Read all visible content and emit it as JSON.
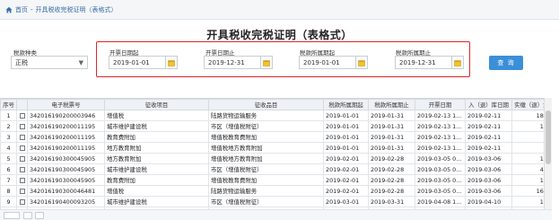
{
  "breadcrumb": {
    "home": "首页",
    "separator": "-",
    "current": "开具税收完税证明（表格式）"
  },
  "title": "开具税收完税证明（表格式）",
  "filters": {
    "tax_type": {
      "label": "税款种类",
      "value": "正税",
      "arrow": "▼"
    },
    "issue_start": {
      "label": "开票日期起",
      "value": "2019-01-01"
    },
    "issue_end": {
      "label": "开票日期止",
      "value": "2019-12-31"
    },
    "period_start": {
      "label": "税款所属期起",
      "value": "2019-01-01"
    },
    "period_end": {
      "label": "税款所属期止",
      "value": "2019-12-31"
    },
    "query_label": "查 询",
    "highlight_color": "#d9262b",
    "accent_color": "#3b8fd9"
  },
  "table": {
    "headers": [
      "序号",
      "",
      "电子税票号",
      "征收项目",
      "征收品目",
      "税款所属期起",
      "税款所属期止",
      "开票日期",
      "入（退）库日期",
      "实缴（退）金额"
    ],
    "rows": [
      [
        "1",
        "",
        "342016190200003946",
        "增值税",
        "陆路货物运输服务",
        "2019-01-01",
        "2019-01-31",
        "2019-02-13 1...",
        "2019-02-11",
        "18281"
      ],
      [
        "2",
        "",
        "342016190200011195",
        "城市维护建设税",
        "市区（增值税附征）",
        "2019-01-01",
        "2019-01-31",
        "2019-02-13 1...",
        "2019-02-11",
        "1280"
      ],
      [
        "3",
        "",
        "342016190200011195",
        "教育费附加",
        "增值税教育费附加",
        "2019-01-01",
        "2019-01-31",
        "2019-02-13 1...",
        "2019-02-11",
        "548"
      ],
      [
        "4",
        "",
        "342016190200011195",
        "地方教育附加",
        "增值税地方教育附加",
        "2019-01-01",
        "2019-01-31",
        "2019-02-13 1...",
        "2019-02-11",
        "365"
      ],
      [
        "5",
        "",
        "342016190300045905",
        "地方教育附加",
        "增值税地方教育附加",
        "2019-02-01",
        "2019-02-28",
        "2019-03-05 0...",
        "2019-03-06",
        "1144"
      ],
      [
        "6",
        "",
        "342016190300045905",
        "城市维护建设税",
        "市区（增值税附征）",
        "2019-02-01",
        "2019-02-28",
        "2019-03-05 0...",
        "2019-03-06",
        "4006"
      ],
      [
        "7",
        "",
        "342016190300045905",
        "教育费附加",
        "增值税教育费附加",
        "2019-02-01",
        "2019-02-28",
        "2019-03-05 0...",
        "2019-03-06",
        "1716"
      ],
      [
        "8",
        "",
        "342016190300046481",
        "增值税",
        "陆路货物运输服务",
        "2019-02-01",
        "2019-02-28",
        "2019-03-05 0...",
        "2019-03-06",
        "16353"
      ],
      [
        "9",
        "",
        "342016190400093205",
        "城市维护建设税",
        "市区（增值税附征）",
        "2019-03-01",
        "2019-03-31",
        "2019-04-08 1...",
        "2019-04-10",
        "1109"
      ],
      [
        "10",
        "",
        "342016190400093205",
        "教育费附加",
        "增值税教育费附加",
        "2019-03-01",
        "2019-03-31",
        "2019-04-08 1...",
        "2019-04-10",
        "475"
      ]
    ]
  }
}
